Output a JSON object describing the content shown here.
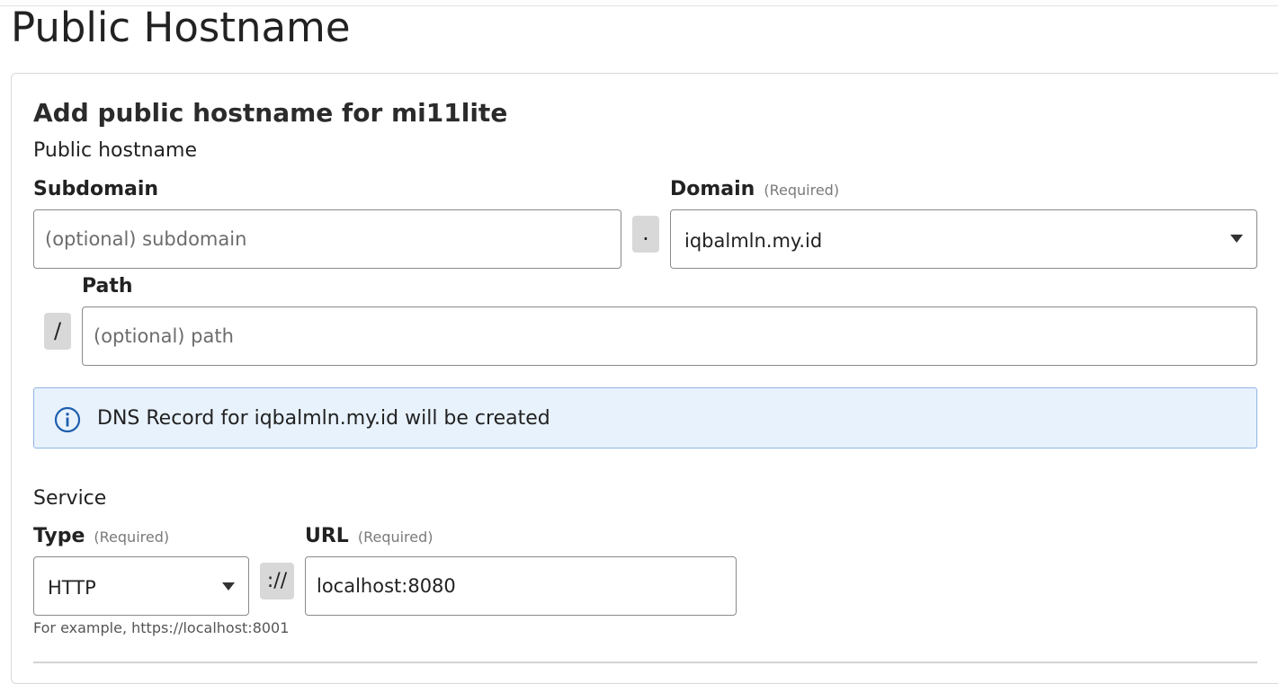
{
  "page": {
    "title": "Public Hostname"
  },
  "form": {
    "title": "Add public hostname for mi11lite",
    "public_hostname_section": "Public hostname",
    "subdomain": {
      "label": "Subdomain",
      "placeholder": "(optional) subdomain",
      "value": ""
    },
    "dot_separator": ".",
    "domain": {
      "label": "Domain",
      "required_hint": "(Required)",
      "value": "iqbalmln.my.id",
      "icon": "caret-down-icon"
    },
    "path": {
      "label": "Path",
      "prefix": "/",
      "placeholder": "(optional) path",
      "value": ""
    },
    "dns_notice": {
      "icon": "info-icon",
      "text": "DNS Record for iqbalmln.my.id will be created",
      "border_color": "#8fb6e0",
      "background_color": "#e8f2fd",
      "icon_color": "#1f5fae"
    },
    "service_section": "Service",
    "type": {
      "label": "Type",
      "required_hint": "(Required)",
      "value": "HTTP",
      "icon": "caret-down-icon"
    },
    "scheme_separator": "://",
    "url": {
      "label": "URL",
      "required_hint": "(Required)",
      "value": "localhost:8080"
    },
    "helper_text": "For example, https://localhost:8001"
  }
}
